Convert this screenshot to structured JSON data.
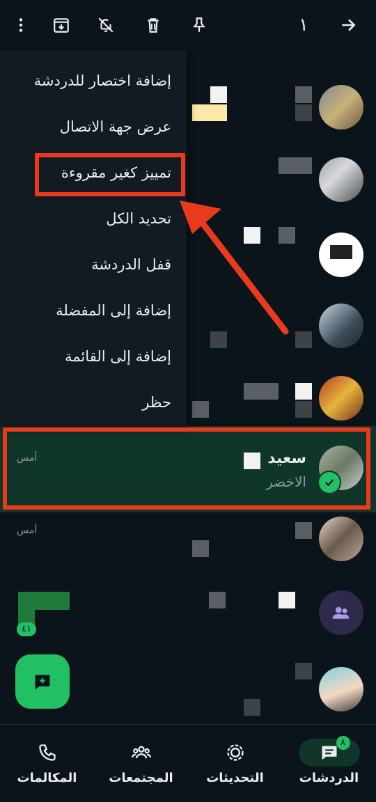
{
  "topbar": {
    "selected_count": "١",
    "icons": [
      "more-vertical-icon",
      "archive-icon",
      "mute-icon",
      "delete-icon",
      "pin-icon",
      "back-arrow-icon"
    ]
  },
  "menu": {
    "items": [
      "إضافة اختصار للدردشة",
      "عرض جهة الاتصال",
      "تمييز كغير مقروءة",
      "تحديد الكل",
      "قفل الدردشة",
      "إضافة إلى المفضلة",
      "إضافة إلى القائمة",
      "حظر"
    ]
  },
  "selected_chat": {
    "name": "سعيد",
    "subtitle": "الاخضر",
    "time": "أمس"
  },
  "chat_after": {
    "time": "أمس"
  },
  "unread": "٤١",
  "bottom_nav": {
    "chats": "الدردشات",
    "chats_badge": "٨",
    "updates": "التحديثات",
    "communities": "المجتمعات",
    "calls": "المكالمات"
  },
  "colors": {
    "accent": "#21c063",
    "annotation": "#ea3a1e",
    "background": "#0b141a"
  }
}
